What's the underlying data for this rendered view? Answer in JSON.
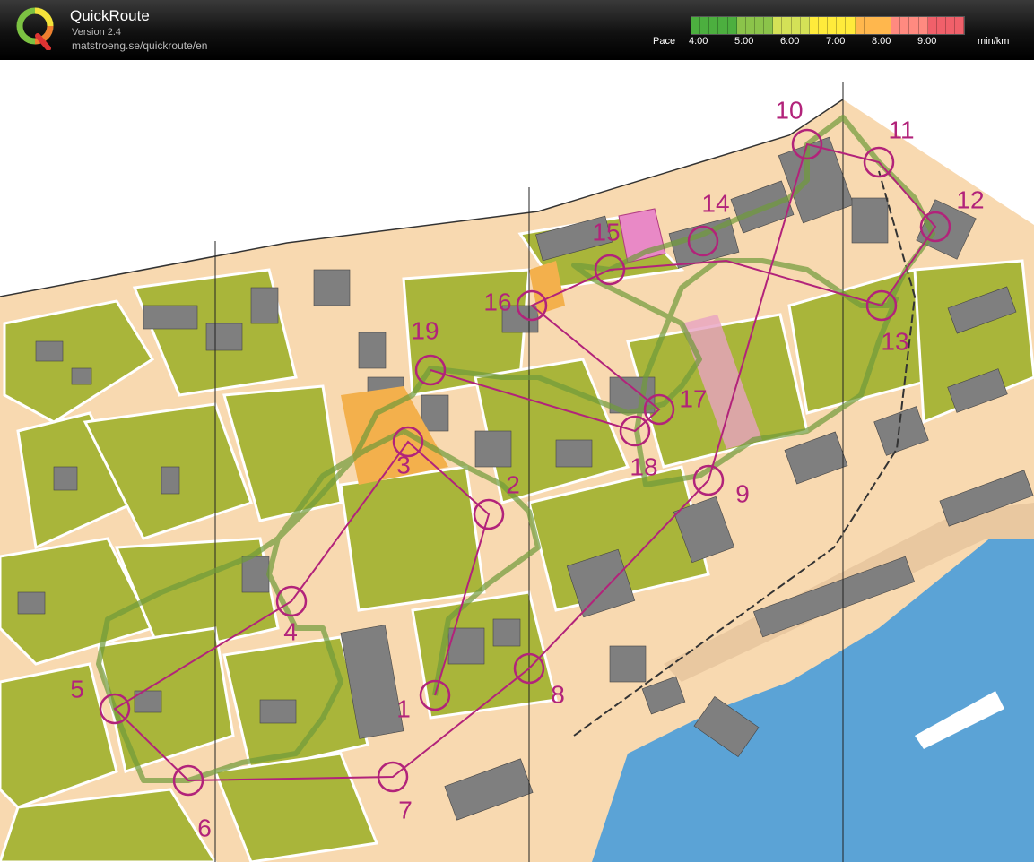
{
  "app": {
    "title": "QuickRoute",
    "version": "Version 2.4",
    "url": "matstroeng.se/quickroute/en"
  },
  "pace_legend": {
    "label": "Pace",
    "unit": "min/km",
    "ticks": [
      "4:00",
      "5:00",
      "6:00",
      "7:00",
      "8:00",
      "9:00"
    ],
    "colors": [
      "#4caf3f",
      "#8bc34a",
      "#d4e157",
      "#ffeb3b",
      "#ffb74d",
      "#ff8a80",
      "#f0606a"
    ]
  },
  "map": {
    "colors": {
      "open": "#f8d9b0",
      "vegetation": "#a9b53a",
      "building": "#7f7f7f",
      "water": "#5ba3d6",
      "route": "#6f9a3a",
      "course": "#b2237a"
    },
    "controls": [
      "1",
      "2",
      "3",
      "4",
      "5",
      "6",
      "7",
      "8",
      "9",
      "10",
      "11",
      "12",
      "13",
      "14",
      "15",
      "16",
      "17",
      "18",
      "19"
    ]
  }
}
